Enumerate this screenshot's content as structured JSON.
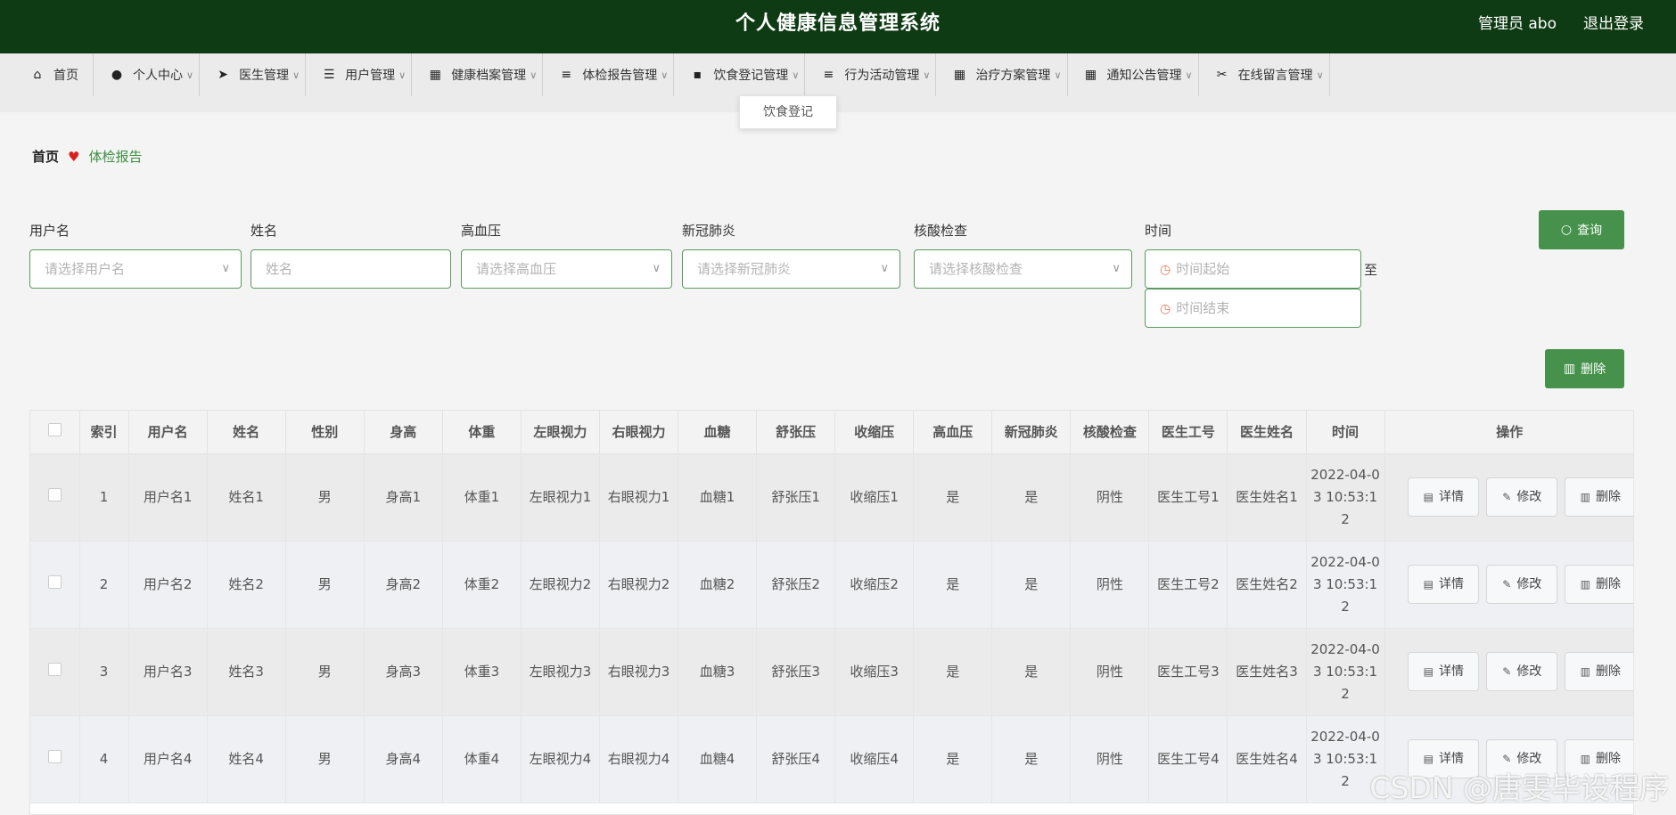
{
  "header": {
    "title": "个人健康信息管理系统",
    "admin": "管理员 abo",
    "logout": "退出登录"
  },
  "nav": {
    "items": [
      {
        "label": "首页",
        "icon": "home-icon",
        "glyph": "⌂",
        "dropdown": false
      },
      {
        "label": "个人中心",
        "icon": "user-icon",
        "glyph": "●",
        "dropdown": true
      },
      {
        "label": "医生管理",
        "icon": "send-icon",
        "glyph": "➤",
        "dropdown": true
      },
      {
        "label": "用户管理",
        "icon": "sliders-icon",
        "glyph": "☰",
        "dropdown": true
      },
      {
        "label": "健康档案管理",
        "icon": "grid-icon",
        "glyph": "▦",
        "dropdown": true
      },
      {
        "label": "体检报告管理",
        "icon": "list-icon",
        "glyph": "≡",
        "dropdown": true
      },
      {
        "label": "饮食登记管理",
        "icon": "message-icon",
        "glyph": "▪",
        "dropdown": true
      },
      {
        "label": "行为活动管理",
        "icon": "list-icon",
        "glyph": "≡",
        "dropdown": true
      },
      {
        "label": "治疗方案管理",
        "icon": "grid-icon",
        "glyph": "▦",
        "dropdown": true
      },
      {
        "label": "通知公告管理",
        "icon": "grid-icon",
        "glyph": "▦",
        "dropdown": true
      },
      {
        "label": "在线留言管理",
        "icon": "ticket-icon",
        "glyph": "✂",
        "dropdown": true
      }
    ],
    "dropdown_open": "饮食登记"
  },
  "breadcrumb": {
    "home": "首页",
    "current": "体检报告"
  },
  "search": {
    "username": {
      "label": "用户名",
      "placeholder": "请选择用户名"
    },
    "name": {
      "label": "姓名",
      "placeholder": "姓名"
    },
    "hypertension": {
      "label": "高血压",
      "placeholder": "请选择高血压"
    },
    "covid": {
      "label": "新冠肺炎",
      "placeholder": "请选择新冠肺炎"
    },
    "nucleic": {
      "label": "核酸检查",
      "placeholder": "请选择核酸检查"
    },
    "time": {
      "label": "时间",
      "start_placeholder": "时间起始",
      "end_placeholder": "时间结束",
      "separator": "至"
    },
    "query_label": "查询",
    "delete_label": "删除"
  },
  "table": {
    "columns": [
      "索引",
      "用户名",
      "姓名",
      "性别",
      "身高",
      "体重",
      "左眼视力",
      "右眼视力",
      "血糖",
      "舒张压",
      "收缩压",
      "高血压",
      "新冠肺炎",
      "核酸检查",
      "医生工号",
      "医生姓名",
      "时间",
      "操作"
    ],
    "rows": [
      [
        "1",
        "用户名1",
        "姓名1",
        "男",
        "身高1",
        "体重1",
        "左眼视力1",
        "右眼视力1",
        "血糖1",
        "舒张压1",
        "收缩压1",
        "是",
        "是",
        "阴性",
        "医生工号1",
        "医生姓名1",
        "2022-04-03 10:53:12"
      ],
      [
        "2",
        "用户名2",
        "姓名2",
        "男",
        "身高2",
        "体重2",
        "左眼视力2",
        "右眼视力2",
        "血糖2",
        "舒张压2",
        "收缩压2",
        "是",
        "是",
        "阴性",
        "医生工号2",
        "医生姓名2",
        "2022-04-03 10:53:12"
      ],
      [
        "3",
        "用户名3",
        "姓名3",
        "男",
        "身高3",
        "体重3",
        "左眼视力3",
        "右眼视力3",
        "血糖3",
        "舒张压3",
        "收缩压3",
        "是",
        "是",
        "阴性",
        "医生工号3",
        "医生姓名3",
        "2022-04-03 10:53:12"
      ],
      [
        "4",
        "用户名4",
        "姓名4",
        "男",
        "身高4",
        "体重4",
        "左眼视力4",
        "右眼视力4",
        "血糖4",
        "舒张压4",
        "收缩压4",
        "是",
        "是",
        "阴性",
        "医生工号4",
        "医生姓名4",
        "2022-04-03 10:53:12"
      ]
    ],
    "actions": {
      "detail": "详情",
      "edit": "修改",
      "delete": "删除"
    }
  },
  "watermark": "CSDN @唐雯毕设程序"
}
